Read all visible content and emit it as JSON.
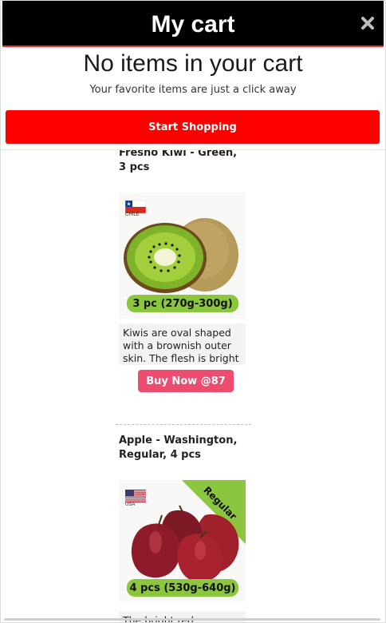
{
  "cart": {
    "title": "My cart",
    "close_icon": "close-icon",
    "empty_title": "No items in your cart",
    "empty_subtitle": "Your favorite items are just a click away",
    "start_button": "Start Shopping"
  },
  "products": [
    {
      "name": "Fresho Kiwi - Green, 3 pcs",
      "flag_label": "CHILE",
      "quantity": "3 pc (270g-300g)",
      "description": "Kiwis are oval shaped with a brownish outer skin. The flesh is bright green",
      "buy_label": "Buy Now @87"
    },
    {
      "name": "Apple - Washington, Regular, 4 pcs",
      "flag_label": "USA",
      "ribbon": "Regular",
      "quantity": "4 pcs (530g-640g)",
      "description": "The bright red"
    }
  ],
  "colors": {
    "header_bg": "#000000",
    "start_button": "#ff0000",
    "buy_button": "#ee4c6e",
    "quantity_badge": "#8cc63f"
  }
}
